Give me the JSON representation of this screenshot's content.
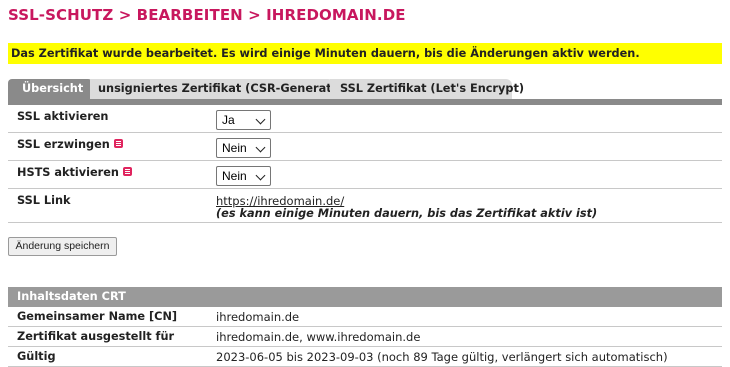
{
  "header": {
    "title": "SSL-SCHUTZ > BEARBEITEN > IHREDOMAIN.DE"
  },
  "notice": {
    "text": "Das Zertifikat wurde bearbeitet. Es wird einige Minuten dauern, bis die Änderungen aktiv werden."
  },
  "tabs": [
    {
      "label": "Übersicht",
      "active": true
    },
    {
      "label": "unsigniertes Zertifikat (CSR-Generator)",
      "active": false
    },
    {
      "label": "SSL Zertifikat (Let's Encrypt)",
      "active": false
    }
  ],
  "form": {
    "ssl_activate": {
      "label": "SSL aktivieren",
      "value": "Ja"
    },
    "ssl_force": {
      "label": "SSL erzwingen",
      "value": "Nein"
    },
    "hsts": {
      "label": "HSTS aktivieren",
      "value": "Nein"
    },
    "ssl_link": {
      "label": "SSL Link",
      "url": "https://ihredomain.de/",
      "note": "(es kann einige Minuten dauern, bis das Zertifikat aktiv ist)"
    }
  },
  "save_button": {
    "label": "Änderung speichern"
  },
  "crt": {
    "header": "Inhaltsdaten CRT",
    "rows": [
      {
        "label": "Gemeinsamer Name [CN]",
        "value": "ihredomain.de"
      },
      {
        "label": "Zertifikat ausgestellt für",
        "value": "ihredomain.de, www.ihredomain.de"
      },
      {
        "label": "Gültig",
        "value": "2023-06-05 bis 2023-09-03 (noch 89 Tage gültig, verlängert sich automatisch)"
      }
    ]
  },
  "colors": {
    "title": "#c8175e",
    "notice_bg": "#ffff00",
    "tab_active": "#8a8a8a",
    "tab_inactive": "#dcdcdc",
    "help_icon": "#e0245e"
  }
}
